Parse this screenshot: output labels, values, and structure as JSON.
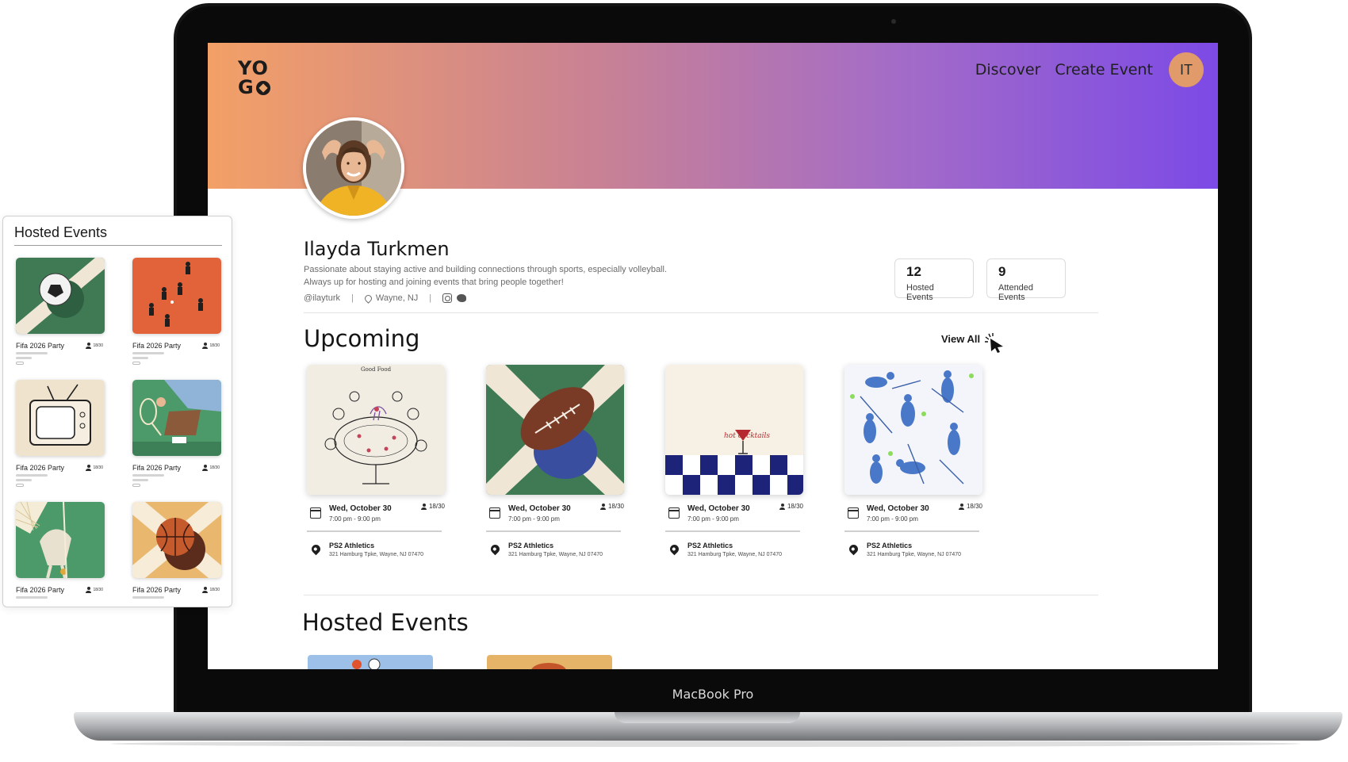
{
  "device": {
    "label": "MacBook Pro"
  },
  "app": {
    "logo_line1": "YO",
    "logo_line2": "G"
  },
  "nav": {
    "discover": "Discover",
    "create_event": "Create Event",
    "avatar_initials": "IT"
  },
  "profile": {
    "name": "Ilayda Turkmen",
    "bio_line1": "Passionate about staying active and building connections through sports, especially volleyball.",
    "bio_line2": "Always up for hosting and joining events that bring people together!",
    "handle": "@ilayturk",
    "location": "Wayne, NJ"
  },
  "stats": {
    "hosted": {
      "value": "12",
      "label": "Hosted Events"
    },
    "attended": {
      "value": "9",
      "label": "Attended Events"
    }
  },
  "upcoming": {
    "title": "Upcoming",
    "view_all": "View All",
    "cards": [
      {
        "art": "dinner",
        "art_text": "Good Food",
        "date": "Wed, October 30",
        "time": "7:00 pm - 9:00 pm",
        "capacity": "18/30",
        "venue": "PS2 Athletics",
        "address": "321 Hamburg Tpke, Wayne, NJ 07470"
      },
      {
        "art": "football",
        "date": "Wed, October 30",
        "time": "7:00 pm - 9:00 pm",
        "capacity": "18/30",
        "venue": "PS2 Athletics",
        "address": "321 Hamburg Tpke, Wayne, NJ 07470"
      },
      {
        "art": "cocktail",
        "art_text": "hot cocktails",
        "date": "Wed, October 30",
        "time": "7:00 pm - 9:00 pm",
        "capacity": "18/30",
        "venue": "PS2 Athletics",
        "address": "321 Hamburg Tpke, Wayne, NJ 07470"
      },
      {
        "art": "tennis",
        "date": "Wed, October 30",
        "time": "7:00 pm - 9:00 pm",
        "capacity": "18/30",
        "venue": "PS2 Athletics",
        "address": "321 Hamburg Tpke, Wayne, NJ 07470"
      }
    ]
  },
  "hosted": {
    "title": "Hosted Events"
  },
  "panel": {
    "title": "Hosted Events",
    "items": [
      {
        "art": "soccer",
        "name": "Fifa 2026 Party",
        "capacity": "18/30"
      },
      {
        "art": "players",
        "name": "Fifa 2026 Party",
        "capacity": "18/30"
      },
      {
        "art": "tv",
        "name": "Fifa 2026 Party",
        "capacity": "18/30"
      },
      {
        "art": "racket",
        "name": "Fifa 2026 Party",
        "capacity": "18/30"
      },
      {
        "art": "badminton",
        "name": "Fifa 2026 Party",
        "capacity": "18/30"
      },
      {
        "art": "basketball",
        "name": "Fifa 2026 Party",
        "capacity": "18/30"
      }
    ]
  },
  "colors": {
    "banner_start": "#f3a066",
    "banner_end": "#7c4ae6",
    "avatar": "#e19a69"
  }
}
